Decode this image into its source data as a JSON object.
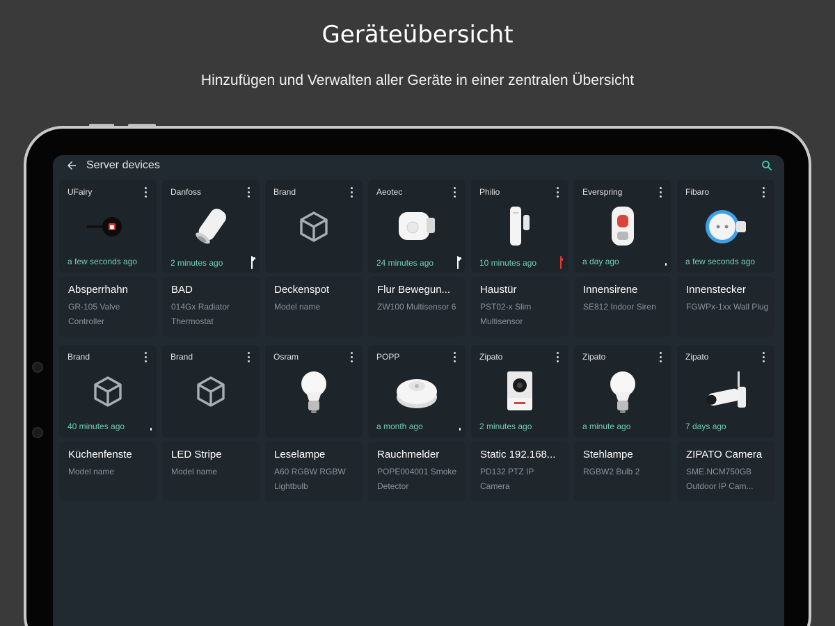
{
  "promo": {
    "title": "Geräteübersicht",
    "subtitle": "Hinzufügen und Verwalten aller Geräte in einer zentralen Übersicht"
  },
  "appbar": {
    "title": "Server devices",
    "back_icon": "arrow-left-icon",
    "search_icon": "search-icon"
  },
  "colors": {
    "screen_bg": "#222a31",
    "card_bg": "#1d242a",
    "accent_time": "#6fcfb7",
    "battery_warning": "#e53935"
  },
  "devices": [
    {
      "brand": "UFairy",
      "time": "a few seconds ago",
      "battery": "none",
      "name": "Absperrhahn",
      "model": "GR-105 Valve Controller",
      "image": "valve-controller"
    },
    {
      "brand": "Danfoss",
      "time": "2 minutes ago",
      "battery": "white-low",
      "name": "BAD",
      "model": "014Gx Radiator Thermostat",
      "image": "thermostat"
    },
    {
      "brand": "Brand",
      "time": "",
      "battery": "none",
      "name": "Deckenspot",
      "model": "Model name",
      "image": "placeholder-cube"
    },
    {
      "brand": "Aeotec",
      "time": "24 minutes ago",
      "battery": "white-low",
      "name": "Flur Bewegun...",
      "model": "ZW100 Multisensor 6",
      "image": "multisensor"
    },
    {
      "brand": "Philio",
      "time": "10 minutes ago",
      "battery": "red",
      "name": "Haustür",
      "model": "PST02-x Slim Multisensor",
      "image": "door-sensor"
    },
    {
      "brand": "Everspring",
      "time": "a day ago",
      "battery": "white",
      "name": "Innensirene",
      "model": "SE812 Indoor Siren",
      "image": "siren"
    },
    {
      "brand": "Fibaro",
      "time": "a few seconds ago",
      "battery": "none",
      "name": "Innenstecker",
      "model": "FGWPx-1xx Wall Plug",
      "image": "wall-plug"
    },
    {
      "brand": "Brand",
      "time": "40 minutes ago",
      "battery": "white",
      "name": "Küchenfenste",
      "model": "Model name",
      "image": "placeholder-cube"
    },
    {
      "brand": "Brand",
      "time": "",
      "battery": "none",
      "name": "LED Stripe",
      "model": "Model name",
      "image": "placeholder-cube"
    },
    {
      "brand": "Osram",
      "time": "",
      "battery": "none",
      "name": "Leselampe",
      "model": "A60 RGBW RGBW Lightbulb",
      "image": "lightbulb"
    },
    {
      "brand": "POPP",
      "time": "a month ago",
      "battery": "white",
      "name": "Rauchmelder",
      "model": "POPE004001 Smoke Detector",
      "image": "smoke-detector"
    },
    {
      "brand": "Zipato",
      "time": "2 minutes ago",
      "battery": "none",
      "name": "Static 192.168...",
      "model": "PD132 PTZ IP Camera",
      "image": "ip-camera"
    },
    {
      "brand": "Zipato",
      "time": "a minute ago",
      "battery": "none",
      "name": "Stehlampe",
      "model": "RGBW2 Bulb 2",
      "image": "lightbulb"
    },
    {
      "brand": "Zipato",
      "time": "7 days ago",
      "battery": "none",
      "name": "ZIPATO Camera",
      "model": "SME.NCM750GB Outdoor IP Cam...",
      "image": "outdoor-camera"
    }
  ]
}
